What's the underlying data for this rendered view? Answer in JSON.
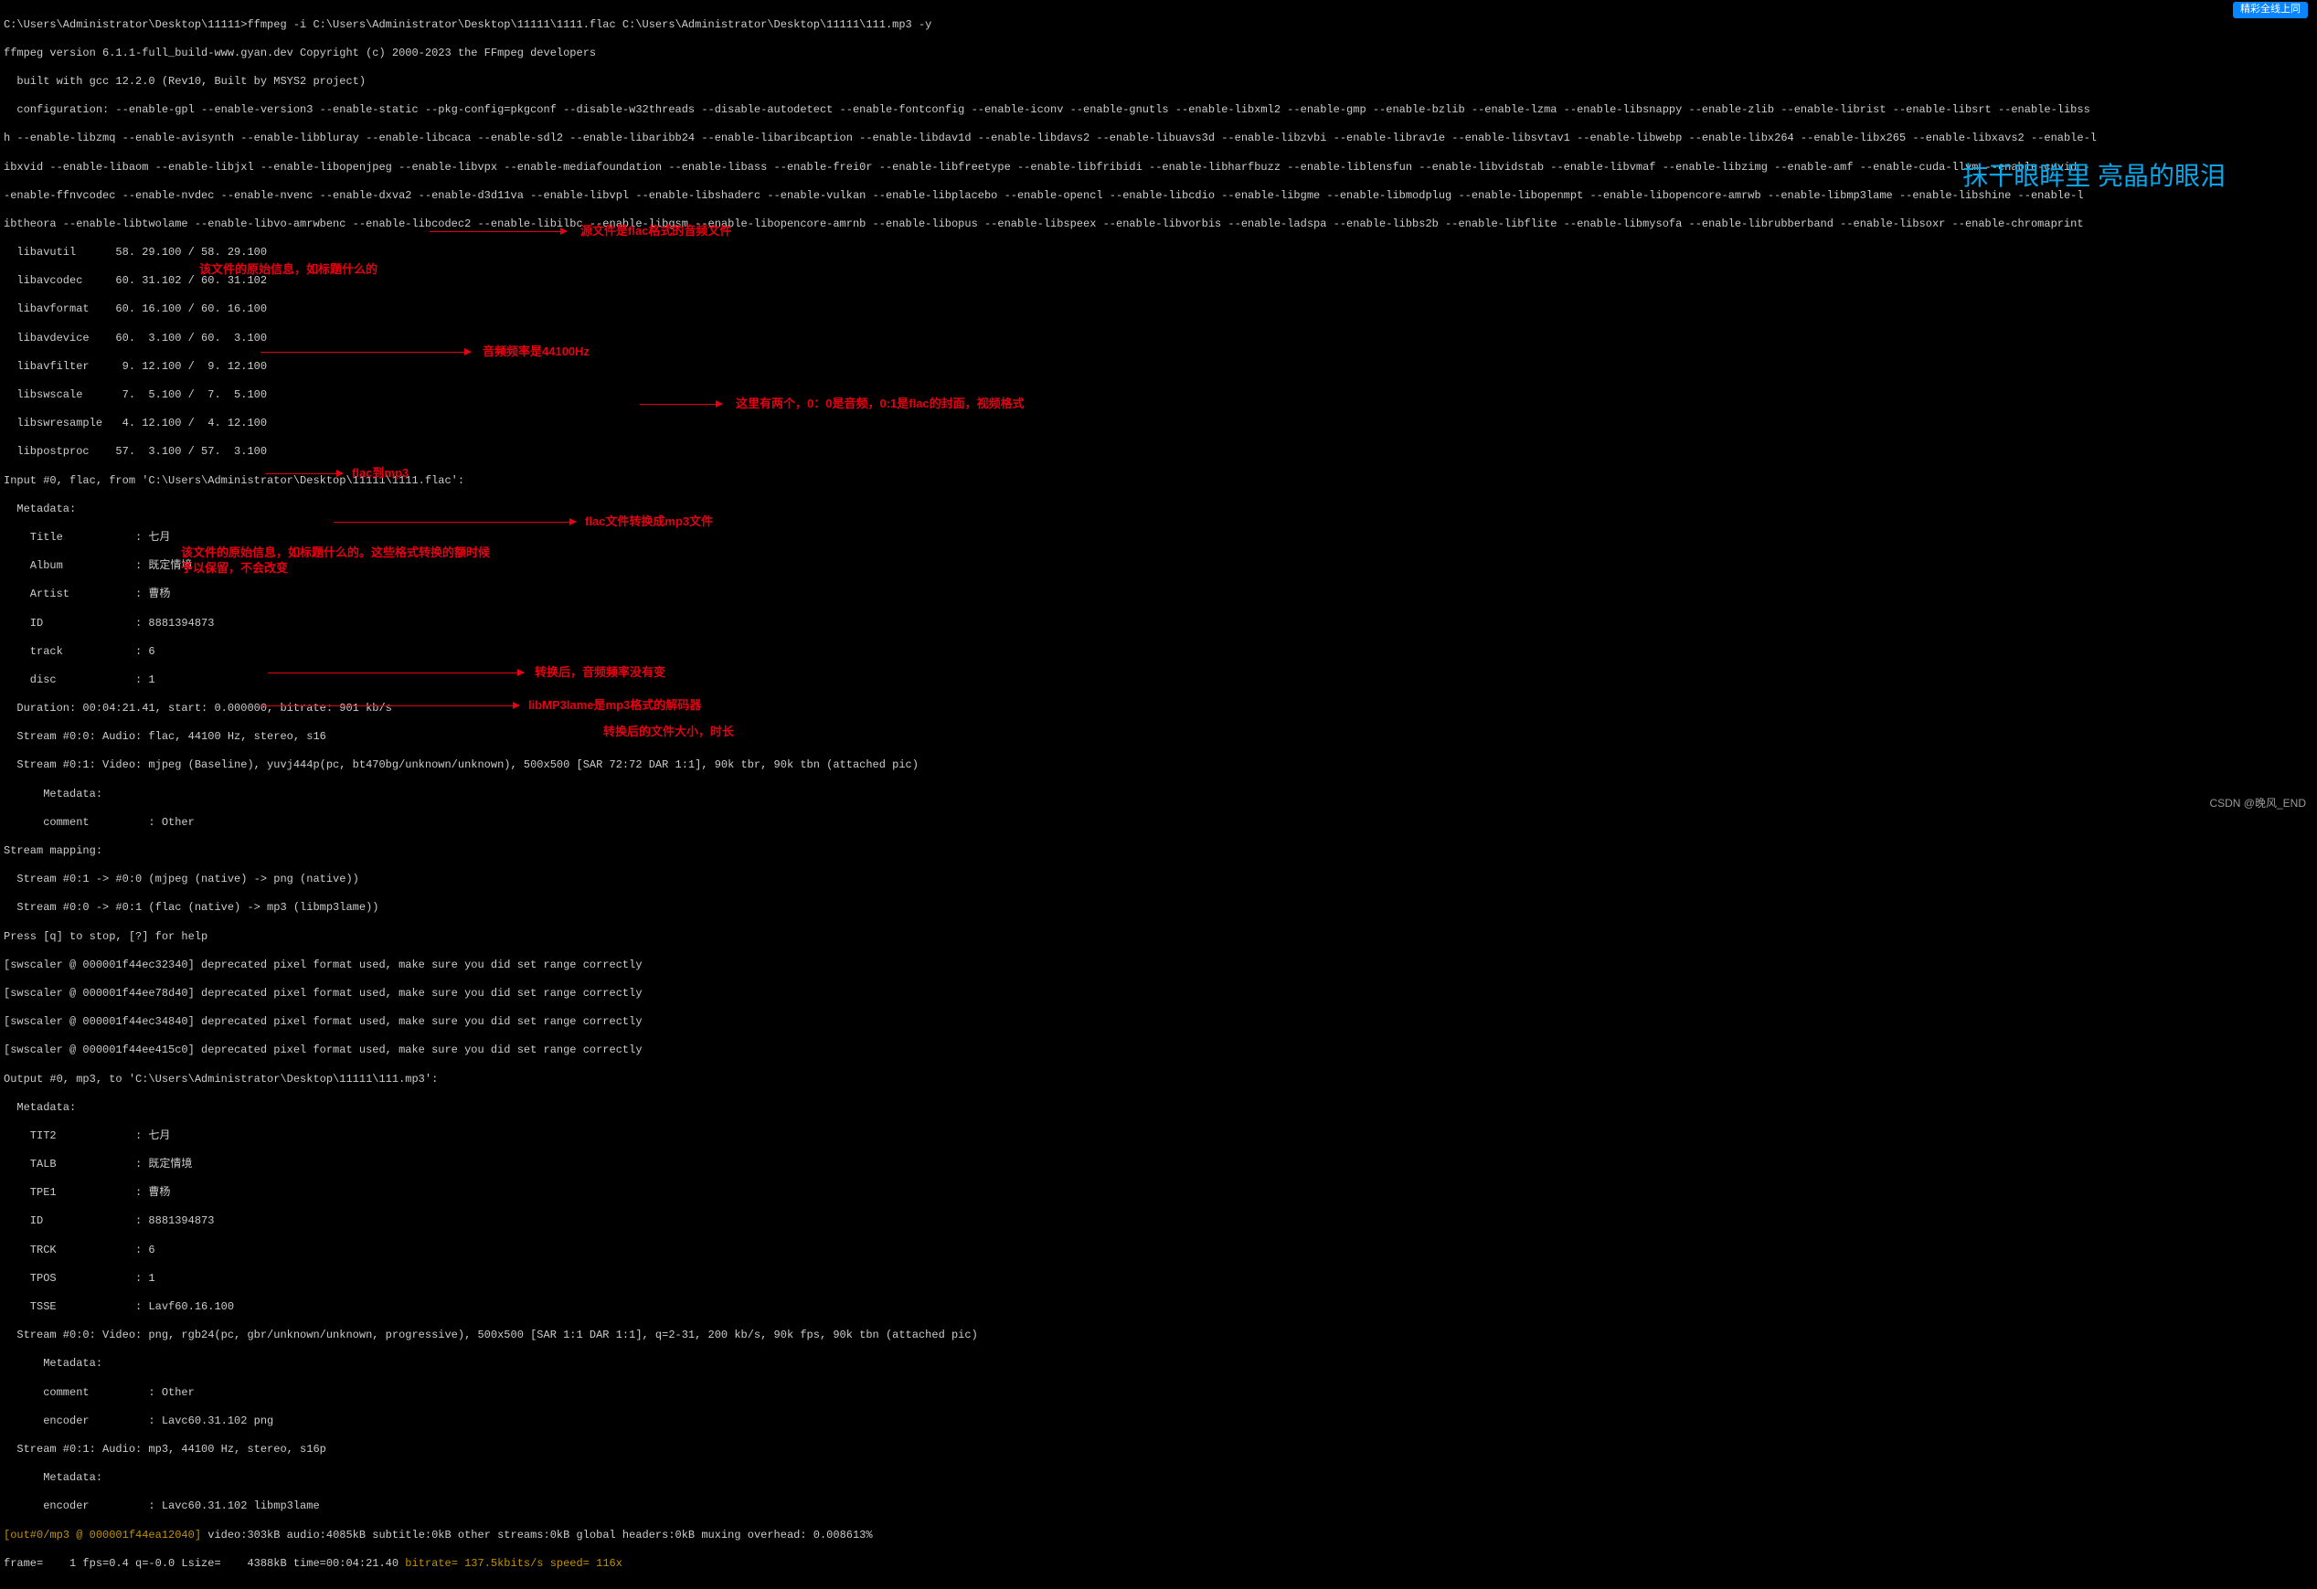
{
  "cmd": "C:\\Users\\Administrator\\Desktop\\11111>ffmpeg -i C:\\Users\\Administrator\\Desktop\\11111\\1111.flac C:\\Users\\Administrator\\Desktop\\11111\\111.mp3 -y",
  "ver": "ffmpeg version 6.1.1-full_build-www.gyan.dev Copyright (c) 2000-2023 the FFmpeg developers",
  "built": "  built with gcc 12.2.0 (Rev10, Built by MSYS2 project)",
  "conf1": "  configuration: --enable-gpl --enable-version3 --enable-static --pkg-config=pkgconf --disable-w32threads --disable-autodetect --enable-fontconfig --enable-iconv --enable-gnutls --enable-libxml2 --enable-gmp --enable-bzlib --enable-lzma --enable-libsnappy --enable-zlib --enable-librist --enable-libsrt --enable-libss",
  "conf2": "h --enable-libzmq --enable-avisynth --enable-libbluray --enable-libcaca --enable-sdl2 --enable-libaribb24 --enable-libaribcaption --enable-libdav1d --enable-libdavs2 --enable-libuavs3d --enable-libzvbi --enable-librav1e --enable-libsvtav1 --enable-libwebp --enable-libx264 --enable-libx265 --enable-libxavs2 --enable-l",
  "conf3": "ibxvid --enable-libaom --enable-libjxl --enable-libopenjpeg --enable-libvpx --enable-mediafoundation --enable-libass --enable-frei0r --enable-libfreetype --enable-libfribidi --enable-libharfbuzz --enable-liblensfun --enable-libvidstab --enable-libvmaf --enable-libzimg --enable-amf --enable-cuda-llvm --enable-cuvid -",
  "conf4": "-enable-ffnvcodec --enable-nvdec --enable-nvenc --enable-dxva2 --enable-d3d11va --enable-libvpl --enable-libshaderc --enable-vulkan --enable-libplacebo --enable-opencl --enable-libcdio --enable-libgme --enable-libmodplug --enable-libopenmpt --enable-libopencore-amrwb --enable-libmp3lame --enable-libshine --enable-l",
  "conf5": "ibtheora --enable-libtwolame --enable-libvo-amrwbenc --enable-libcodec2 --enable-libilbc --enable-libgsm --enable-libopencore-amrnb --enable-libopus --enable-libspeex --enable-libvorbis --enable-ladspa --enable-libbs2b --enable-libflite --enable-libmysofa --enable-librubberband --enable-libsoxr --enable-chromaprint",
  "libs": {
    "avutil": "  libavutil      58. 29.100 / 58. 29.100",
    "avcodec": "  libavcodec     60. 31.102 / 60. 31.102",
    "avformat": "  libavformat    60. 16.100 / 60. 16.100",
    "avdevice": "  libavdevice    60.  3.100 / 60.  3.100",
    "avfilter": "  libavfilter     9. 12.100 /  9. 12.100",
    "swscale": "  libswscale      7.  5.100 /  7.  5.100",
    "swresample": "  libswresample   4. 12.100 /  4. 12.100",
    "postproc": "  libpostproc    57.  3.100 / 57.  3.100"
  },
  "input0": "Input #0, flac, from 'C:\\Users\\Administrator\\Desktop\\11111\\1111.flac':",
  "meta_in": {
    "h": "  Metadata:",
    "title": "    Title           : 七月",
    "album": "    Album           : 既定情境",
    "artist": "    Artist          : 曹杨",
    "id": "    ID              : 8881394873",
    "track": "    track           : 6",
    "disc": "    disc            : 1"
  },
  "dur": "  Duration: 00:04:21.41, start: 0.000000, bitrate: 901 kb/s",
  "s00": "  Stream #0:0: Audio: flac, 44100 Hz, stereo, s16",
  "s01": "  Stream #0:1: Video: mjpeg (Baseline), yuvj444p(pc, bt470bg/unknown/unknown), 500x500 [SAR 72:72 DAR 1:1], 90k tbr, 90k tbn (attached pic)",
  "s01m": "      Metadata:",
  "s01c": "      comment         : Other",
  "smap": "Stream mapping:",
  "map1": "  Stream #0:1 -> #0:0 (mjpeg (native) -> png (native))",
  "map2": "  Stream #0:0 -> #0:1 (flac (native) -> mp3 (libmp3lame))",
  "press": "Press [q] to stop, [?] for help",
  "sw1": "[swscaler @ 000001f44ec32340] deprecated pixel format used, make sure you did set range correctly",
  "sw2": "[swscaler @ 000001f44ee78d40] deprecated pixel format used, make sure you did set range correctly",
  "sw3": "[swscaler @ 000001f44ec34840] deprecated pixel format used, make sure you did set range correctly",
  "sw4": "[swscaler @ 000001f44ee415c0] deprecated pixel format used, make sure you did set range correctly",
  "out0": "Output #0, mp3, to 'C:\\Users\\Administrator\\Desktop\\11111\\111.mp3':",
  "meta_out": {
    "h": "  Metadata:",
    "tit2": "    TIT2            : 七月",
    "talb": "    TALB            : 既定情境",
    "tpe1": "    TPE1            : 曹杨",
    "id": "    ID              : 8881394873",
    "trck": "    TRCK            : 6",
    "tpos": "    TPOS            : 1",
    "tsse": "    TSSE            : Lavf60.16.100"
  },
  "os00": "  Stream #0:0: Video: png, rgb24(pc, gbr/unknown/unknown, progressive), 500x500 [SAR 1:1 DAR 1:1], q=2-31, 200 kb/s, 90k fps, 90k tbn (attached pic)",
  "os00m": "      Metadata:",
  "os00c": "      comment         : Other",
  "os00e": "      encoder         : Lavc60.31.102 png",
  "os01": "  Stream #0:1: Audio: mp3, 44100 Hz, stereo, s16p",
  "os01m": "      Metadata:",
  "os01e": "      encoder         : Lavc60.31.102 libmp3lame",
  "progress_y": "[out#0/mp3 @ 000001f44ea12040] ",
  "progress_w": "video:303kB audio:4085kB subtitle:0kB other streams:0kB global headers:0kB muxing overhead: 0.008613%",
  "frame": "frame=    1 fps=0.4 q=-0.0 Lsize=    4388kB time=00:04:21.40 ",
  "frame_y": "bitrate= 137.5kbits/s speed= 116x",
  "notes": {
    "n1": "源文件是flac格式的音频文件",
    "n2": "该文件的原始信息，如标题什么的",
    "n3": "音频频率是44100Hz",
    "n4": "这里有两个，0：0是音频，0:1是flac的封面，视频格式",
    "n5": "flac到mp3",
    "n6": "flac文件转换成mp3文件",
    "n7": "该文件的原始信息，如标题什么的。这些格式转换的额时候予以保留，不会改变",
    "n8": "转换后，音频频率没有变",
    "n9": "libMP3lame是mp3格式的解码器",
    "n10": "转换后的文件大小，时长"
  },
  "overlay": "抹干眼眸里 亮晶的眼泪",
  "credit": "CSDN @晚风_END",
  "topbtn": "精彩全线上同"
}
